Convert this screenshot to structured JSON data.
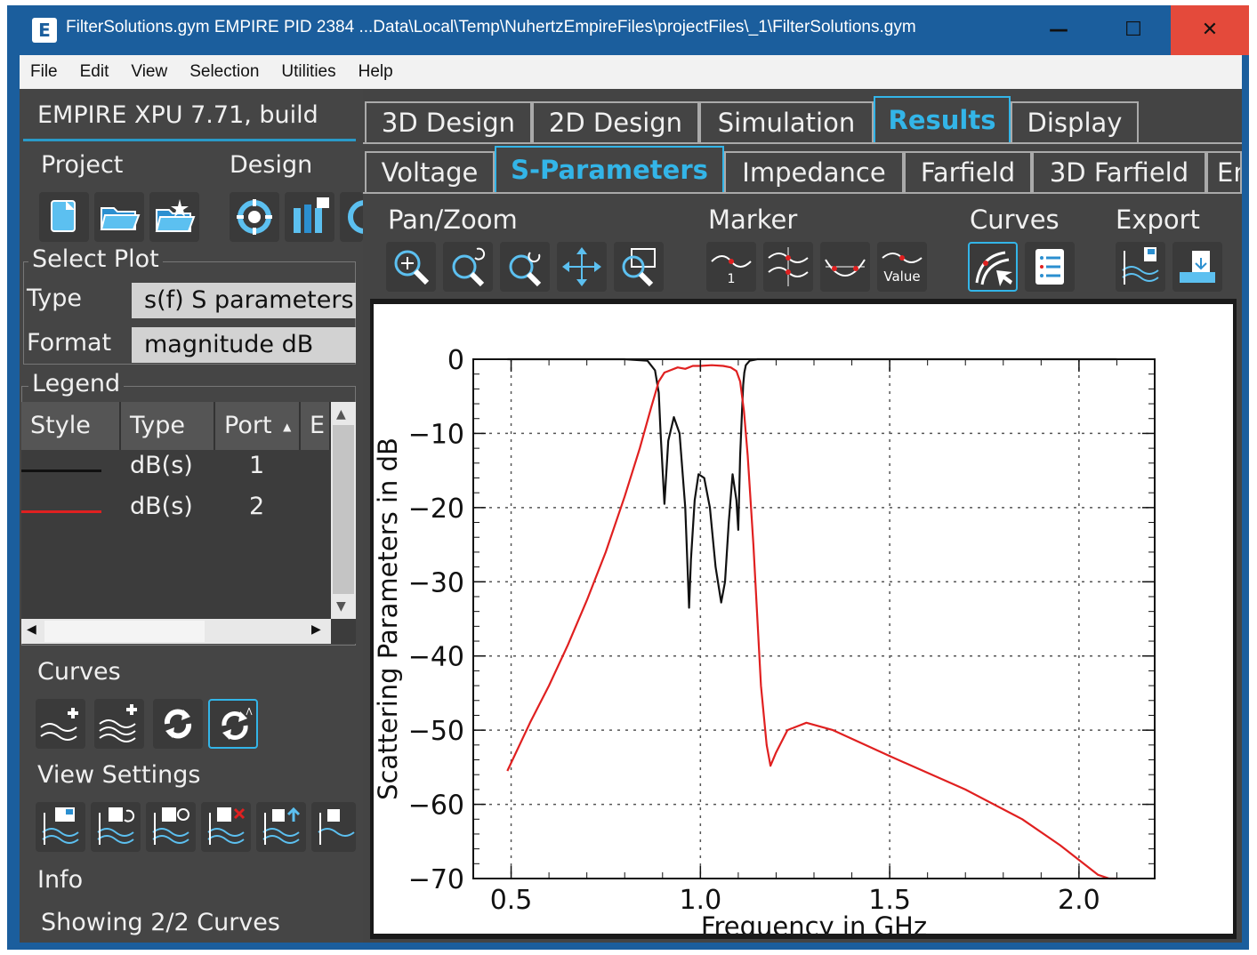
{
  "window": {
    "title": "FilterSolutions.gym EMPIRE PID 2384 ...Data\\Local\\Temp\\NuhertzEmpireFiles\\projectFiles\\_1\\FilterSolutions.gym",
    "app_icon": "E",
    "minimize": "—",
    "maximize": "☐",
    "close": "✕"
  },
  "menu": [
    "File",
    "Edit",
    "View",
    "Selection",
    "Utilities",
    "Help"
  ],
  "left": {
    "version": "EMPIRE XPU 7.71, build",
    "project_label": "Project",
    "design_label": "Design",
    "select_plot_label": "Select Plot",
    "type_label": "Type",
    "type_value": "s(f)  S parameters",
    "format_label": "Format",
    "format_value": "magnitude dB",
    "legend_label": "Legend",
    "legend_headers": [
      "Style",
      "Type",
      "Port",
      "E"
    ],
    "sort_arrow": "▲",
    "legend_rows": [
      {
        "type": "dB(s)",
        "port": "1",
        "color": "#111111"
      },
      {
        "type": "dB(s)",
        "port": "2",
        "color": "#e02020"
      }
    ],
    "curves_label": "Curves",
    "view_settings_label": "View Settings",
    "info_label": "Info",
    "info_value": "Showing 2/2 Curves"
  },
  "tabs_main": [
    "3D Design",
    "2D Design",
    "Simulation",
    "Results",
    "Display"
  ],
  "tabs_main_active": "Results",
  "tabs_sub": [
    "Voltage",
    "S-Parameters",
    "Impedance",
    "Farfield",
    "3D Farfield",
    "En"
  ],
  "tabs_sub_active": "S-Parameters",
  "toolbar": {
    "panzoom_label": "Pan/Zoom",
    "marker_label": "Marker",
    "curves_label": "Curves",
    "export_label": "Export",
    "marker_value_text": "Value",
    "marker_one_text": "1"
  },
  "colors": {
    "accent": "#33b5e8",
    "titlebar": "#1b5e9d",
    "close": "#e44a3b",
    "s11": "#111111",
    "s21": "#e02020"
  },
  "chart_data": {
    "type": "line",
    "xlabel": "Frequency in GHz",
    "ylabel": "Scattering Parameters in dB",
    "xlim": [
      0.4,
      2.2
    ],
    "ylim": [
      -70,
      0
    ],
    "xticks": [
      0.5,
      1.0,
      1.5,
      2.0
    ],
    "xtick_labels": [
      "0.5",
      "1.0",
      "1.5",
      "2.0"
    ],
    "yticks": [
      0,
      -10,
      -20,
      -30,
      -40,
      -50,
      -60,
      -70
    ],
    "ytick_labels": [
      "0",
      "−10",
      "−20",
      "−30",
      "−40",
      "−50",
      "−60",
      "−70"
    ],
    "grid": true,
    "series": [
      {
        "color": "#111111",
        "x": [
          0.49,
          0.8,
          0.86,
          0.88,
          0.89,
          0.895,
          0.905,
          0.915,
          0.93,
          0.945,
          0.96,
          0.97,
          0.975,
          0.985,
          0.995,
          1.01,
          1.025,
          1.04,
          1.055,
          1.065,
          1.075,
          1.085,
          1.095,
          1.1,
          1.105,
          1.11,
          1.113,
          1.116,
          1.12,
          1.13,
          1.15,
          1.2,
          2.1
        ],
        "y": [
          0,
          0,
          -0.2,
          -1.5,
          -4.5,
          -10,
          -19.5,
          -11,
          -7.8,
          -10,
          -20,
          -33.5,
          -27,
          -19,
          -15.5,
          -16,
          -20,
          -28,
          -32.8,
          -30,
          -22,
          -15.5,
          -19,
          -23,
          -13,
          -7,
          -3.5,
          -1.8,
          -0.8,
          -0.2,
          0,
          0,
          0
        ]
      },
      {
        "color": "#e02020",
        "x": [
          0.49,
          0.55,
          0.6,
          0.65,
          0.7,
          0.75,
          0.8,
          0.84,
          0.87,
          0.89,
          0.905,
          0.92,
          0.94,
          0.96,
          0.98,
          1.0,
          1.03,
          1.06,
          1.08,
          1.095,
          1.105,
          1.115,
          1.125,
          1.14,
          1.16,
          1.175,
          1.185,
          1.2,
          1.23,
          1.28,
          1.35,
          1.5,
          1.7,
          1.85,
          1.95,
          2.0,
          2.05,
          2.08,
          2.1
        ],
        "y": [
          -55.5,
          -49,
          -44,
          -38.5,
          -32.5,
          -26,
          -18.5,
          -12,
          -6.5,
          -3,
          -1.8,
          -1.5,
          -1.1,
          -1.3,
          -0.9,
          -0.9,
          -0.8,
          -0.9,
          -1.1,
          -1.6,
          -3,
          -7,
          -13,
          -25,
          -44,
          -52,
          -54.8,
          -53,
          -50,
          -49,
          -50,
          -53.5,
          -58,
          -62,
          -65.5,
          -67.5,
          -69.5,
          -70,
          -70
        ]
      }
    ]
  }
}
